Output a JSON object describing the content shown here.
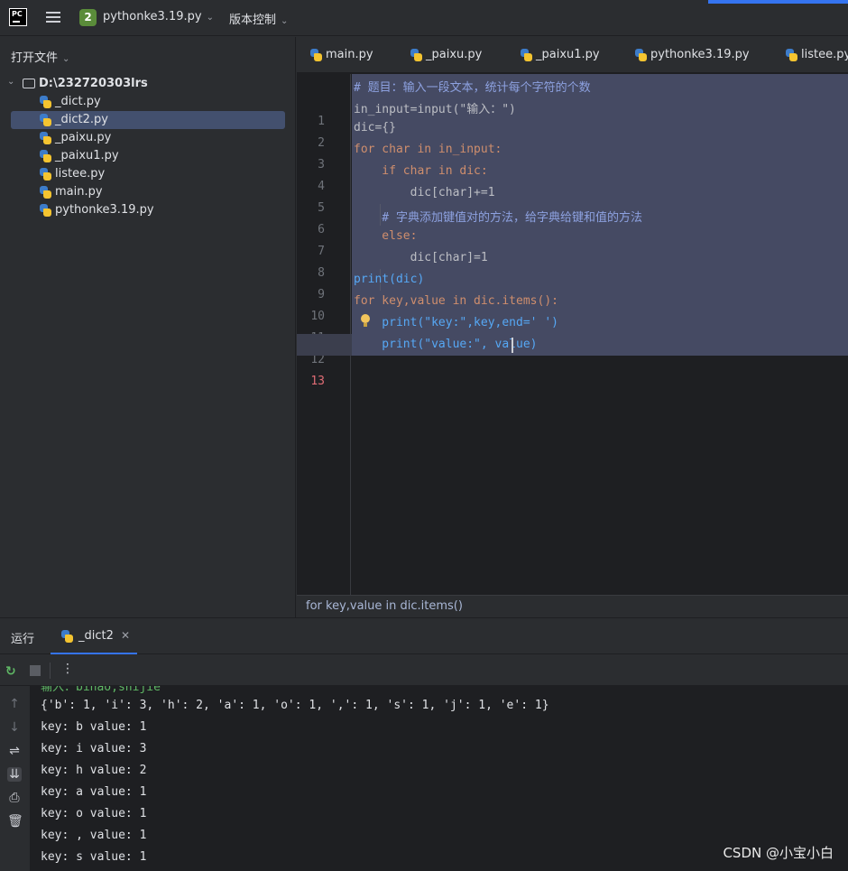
{
  "app": {
    "project_badge": "2",
    "project_name": "pythonke3.19.py",
    "vcs_label": "版本控制"
  },
  "sidebar": {
    "header": "打开文件",
    "root": "D:\\232720303lrs",
    "files": [
      "_dict.py",
      "_dict2.py",
      "_paixu.py",
      "_paixu1.py",
      "listee.py",
      "main.py",
      "pythonke3.19.py"
    ],
    "selected": "_dict2.py"
  },
  "editor": {
    "tabs": [
      "main.py",
      "_paixu.py",
      "_paixu1.py",
      "pythonke3.19.py",
      "listee.py"
    ],
    "line_numbers": [
      "1",
      "2",
      "3",
      "4",
      "5",
      "6",
      "7",
      "8",
      "9",
      "10",
      "11",
      "12",
      "13"
    ],
    "current_line": "13",
    "code": [
      "# 题目：输入一段文本，统计每个字符的个数",
      "in_input=input(\"输入：\")",
      "dic={}",
      "for char in in_input:",
      "    if char in dic:",
      "        dic[char]+=1",
      "    # 字典添加键值对的方法，给字典给键和值的方法",
      "    else:",
      "        dic[char]=1",
      "print(dic)",
      "for key,value in dic.items():",
      "    print(\"key:\",key,end=' ')",
      "    print(\"value:\", value)"
    ],
    "breadcrumb": "for key,value in dic.items()"
  },
  "run": {
    "label": "运行",
    "tab": "_dict2",
    "console_lines": [
      "{'b': 1, 'i': 3, 'h': 2, 'a': 1, 'o': 1, ',': 1, 's': 1, 'j': 1, 'e': 1}",
      "key: b value: 1",
      "key: i value: 3",
      "key: h value: 2",
      "key: a value: 1",
      "key: o value: 1",
      "key: , value: 1",
      "key: s value: 1"
    ],
    "partial_first_line": "输入：binao,shijie"
  },
  "watermark": "CSDN @小宝小白",
  "icons": [
    "pycharm-logo-icon",
    "hamburger-menu-icon",
    "chevron-down-icon",
    "folder-icon",
    "python-file-icon",
    "lightbulb-icon",
    "rerun-icon",
    "stop-icon",
    "more-icon",
    "close-icon",
    "scroll-up-icon",
    "scroll-down-icon",
    "soft-wrap-icon",
    "scroll-to-end-icon",
    "print-icon",
    "trash-icon"
  ],
  "colors": {
    "accent": "#3574f0",
    "selection": "#454a63",
    "keyword": "#cf8e6d",
    "string": "#6aab73",
    "number": "#2aacb8",
    "function": "#56a8f5"
  }
}
